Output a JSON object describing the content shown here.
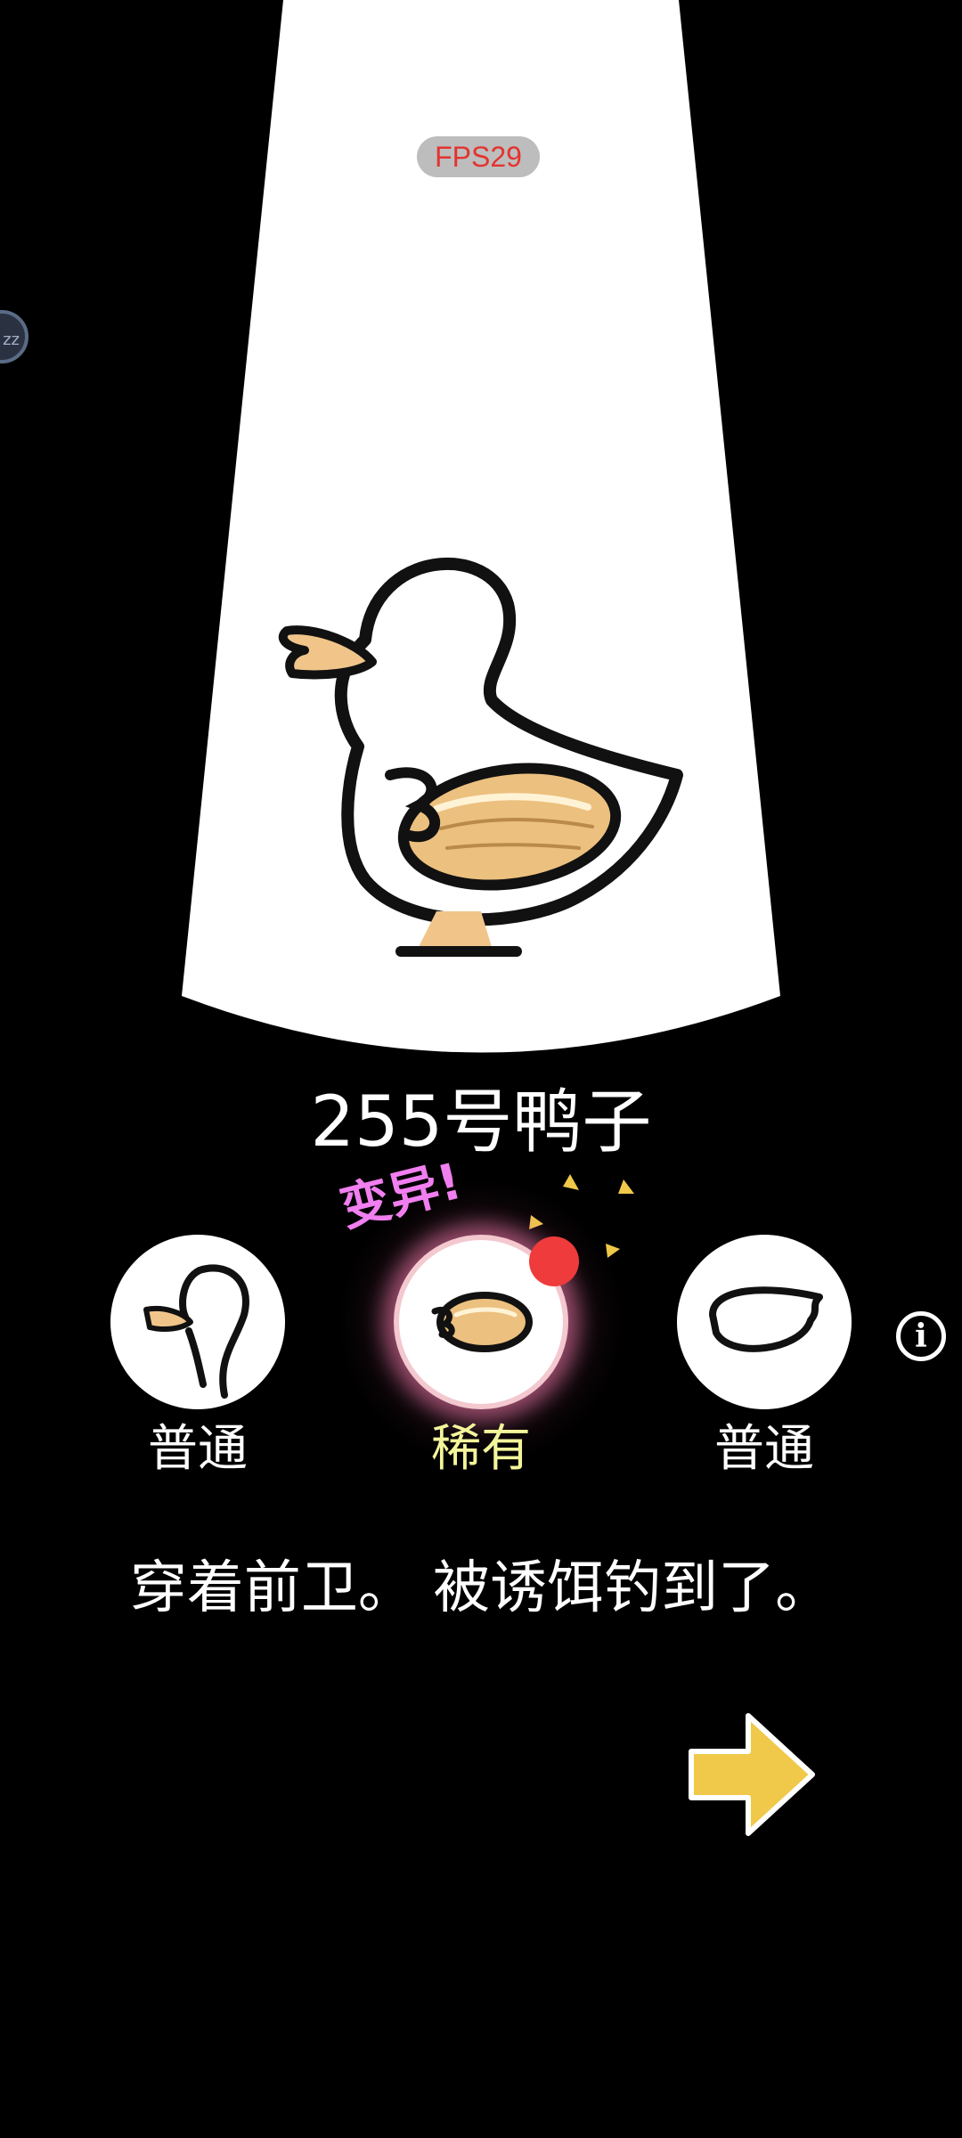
{
  "hud": {
    "fps": "FPS29",
    "side_bubble": "zz"
  },
  "duck": {
    "name": "255号鸭子"
  },
  "mutation": {
    "label": "变异!"
  },
  "parts": [
    {
      "slot": "head",
      "rarity": "普通",
      "icon": "duck-head-icon"
    },
    {
      "slot": "body",
      "rarity": "稀有",
      "icon": "almond-body-icon"
    },
    {
      "slot": "wing",
      "rarity": "普通",
      "icon": "wing-icon"
    }
  ],
  "info": {
    "symbol": "i"
  },
  "description": "穿着前卫。 被诱饵钓到了。",
  "colors": {
    "background": "#000000",
    "spotlight": "#ffffff",
    "common": "#ffffff",
    "rare": "#f3f59a",
    "mutation": "#f07ff0",
    "next_arrow": "#f0c94a"
  },
  "next": {
    "icon": "arrow-right-icon"
  }
}
